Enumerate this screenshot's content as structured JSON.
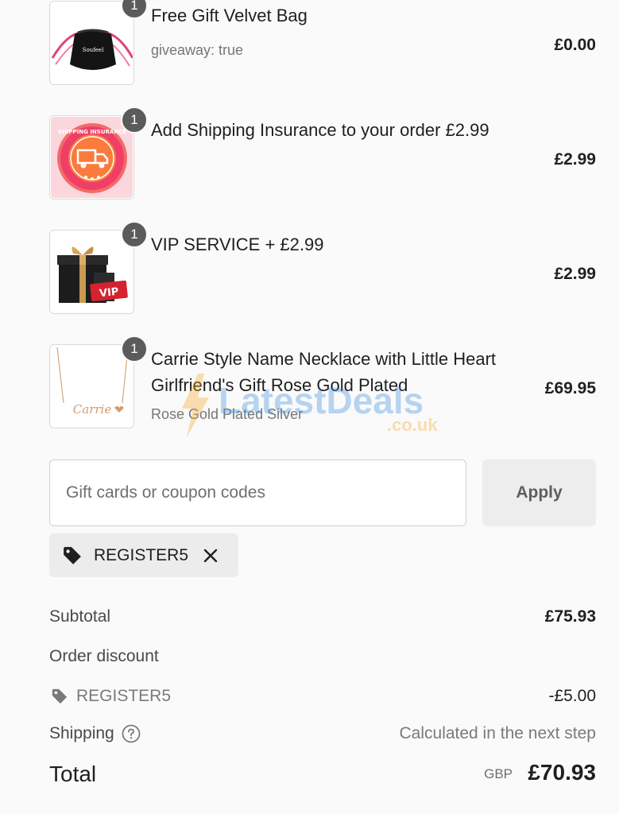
{
  "line_items": [
    {
      "title": "Free Gift Velvet Bag",
      "subtitle": "giveaway: true",
      "price": "£0.00",
      "quantity": "1"
    },
    {
      "title": "Add Shipping Insurance to your order £2.99",
      "subtitle": "",
      "price": "£2.99",
      "quantity": "1"
    },
    {
      "title": "VIP SERVICE + £2.99",
      "subtitle": "",
      "price": "£2.99",
      "quantity": "1"
    },
    {
      "title": "Carrie Style Name Necklace with Little Heart Girlfriend's Gift Rose Gold Plated",
      "subtitle": "Rose Gold Plated Silver",
      "price": "£69.95",
      "quantity": "1"
    }
  ],
  "images": {
    "bag_brand": "Soufeel",
    "insurance_badge": "SHIPPING INSURANCE",
    "vip_label": "VIP",
    "necklace_name": "Carrie"
  },
  "coupon": {
    "placeholder": "Gift cards or coupon codes",
    "value": "",
    "apply_label": "Apply",
    "applied_code": "REGISTER5"
  },
  "summary": {
    "subtotal_label": "Subtotal",
    "subtotal_value": "£75.93",
    "discount_label": "Order discount",
    "discount_code": "REGISTER5",
    "discount_value": "-£5.00",
    "shipping_label": "Shipping",
    "shipping_value": "Calculated in the next step",
    "total_label": "Total",
    "total_currency": "GBP",
    "total_value": "£70.93"
  },
  "watermark": {
    "brand": "LatestDeals",
    "domain": ".co.uk"
  },
  "icons": {
    "tag": "tag-icon",
    "remove": "close-icon",
    "help": "question-circle-icon"
  },
  "colors": {
    "badge": "#5b5b5b",
    "apply_button_bg": "#ededed",
    "chip_bg": "#ececec",
    "watermark_blue": "#3a8dde",
    "watermark_orange": "#f5a623"
  }
}
